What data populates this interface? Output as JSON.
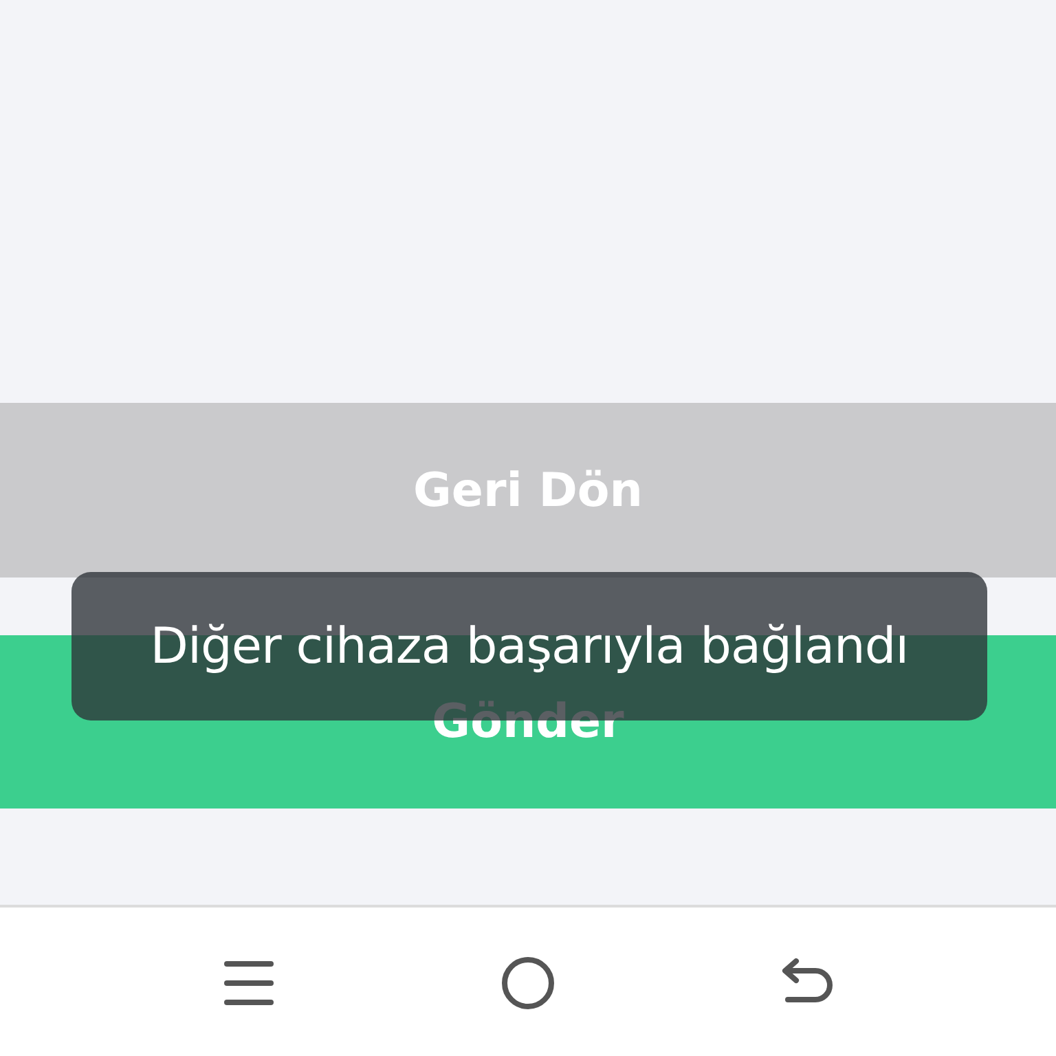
{
  "buttons": [
    {
      "label": "Geri Dön",
      "kind": "secondary"
    },
    {
      "label": "Gönder",
      "kind": "primary"
    }
  ],
  "toast": {
    "text": "Diğer cihaza başarıyla bağlandı"
  }
}
